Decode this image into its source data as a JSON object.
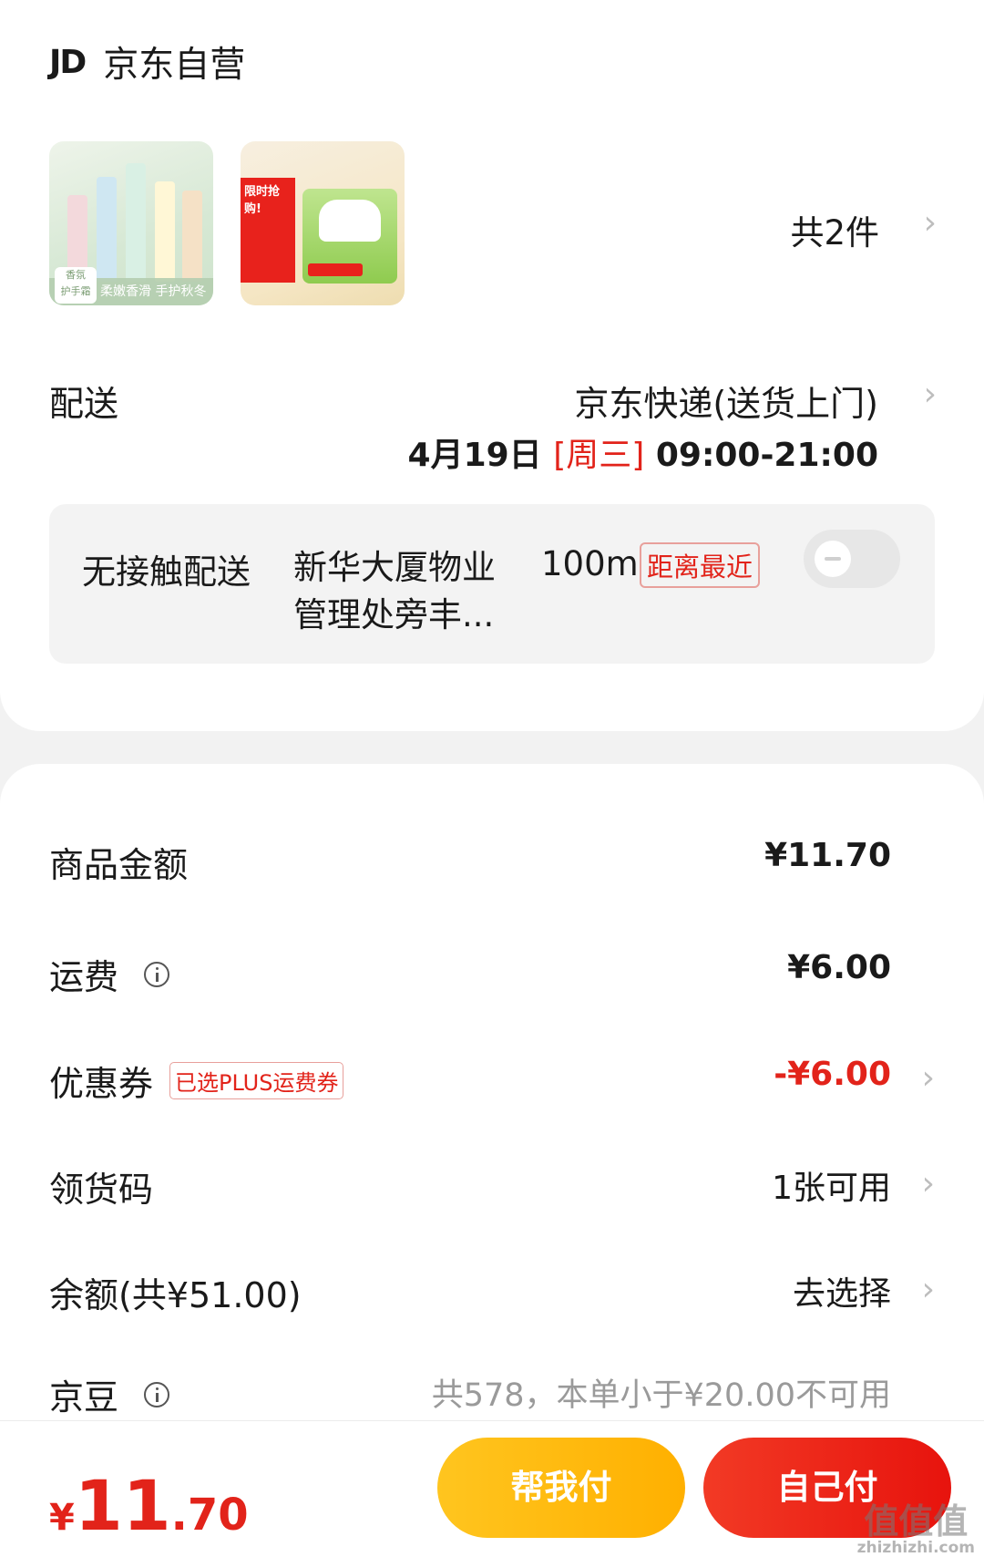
{
  "shop": {
    "logo": "JD",
    "name": "京东自营"
  },
  "products": {
    "count_label": "共2件",
    "items": [
      {
        "name": "hand-cream",
        "badge": "香氛\n护手霜",
        "caption": "柔嫩香滑 手护秋冬"
      },
      {
        "name": "tissue",
        "promo": "限时抢购!"
      }
    ]
  },
  "delivery": {
    "label": "配送",
    "method": "京东快递(送货上门)",
    "date": "4月19日",
    "weekday": "[周三]",
    "time_window": "09:00-21:00"
  },
  "contactless": {
    "label": "无接触配送",
    "place": "新华大厦物业管理处旁丰...",
    "distance": "100m",
    "tag": "距离最近",
    "enabled": false
  },
  "summary": {
    "goods_amount": {
      "label": "商品金额",
      "value": "¥11.70"
    },
    "shipping": {
      "label": "运费",
      "value": "¥6.00"
    },
    "coupon": {
      "label": "优惠券",
      "tag": "已选PLUS运费券",
      "value": "-¥6.00"
    },
    "pickup_code": {
      "label": "领货码",
      "value": "1张可用"
    },
    "balance": {
      "label": "余额(共¥51.00)",
      "value": "去选择"
    },
    "jingdou": {
      "label": "京豆",
      "value": "共578，本单小于¥20.00不可用"
    }
  },
  "footer": {
    "currency": "¥",
    "total_integer": "11",
    "total_decimal": ".70",
    "help_pay": "帮我付",
    "self_pay": "自己付"
  },
  "watermark": {
    "text": "值值值",
    "url": "zhizhizhi.com"
  },
  "colors": {
    "accent_red": "#e2231a",
    "help_yellow": "#ffb000",
    "self_red": "#e7130d"
  }
}
